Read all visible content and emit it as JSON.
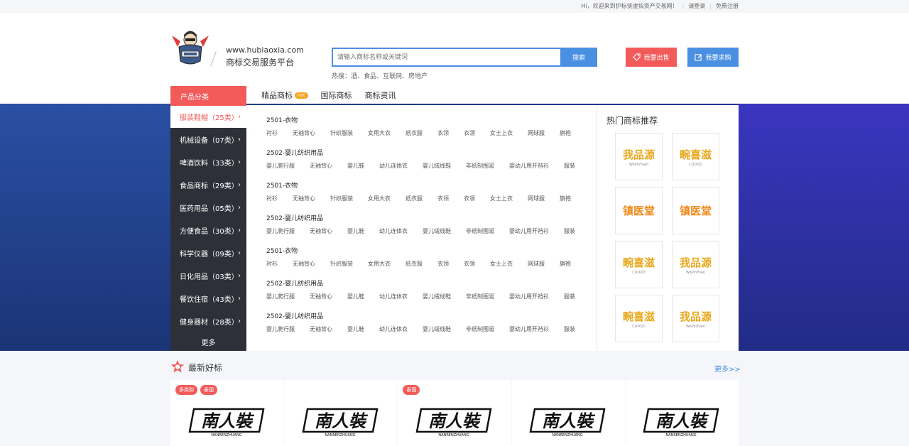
{
  "topbar": {
    "greeting": "Hi，欢迎来到护标侠虚拟资产交易网！",
    "login": "请登录",
    "register": "免费注册"
  },
  "header": {
    "domain": "www.hubiaoxia.com",
    "slogan": "商标交易服务平台",
    "search_placeholder": "请输入商标名称或关键词",
    "search_button": "搜索",
    "hot_words": "热搜：酒、食品、互联网、房地产",
    "sell_button": "我要出售",
    "buy_button": "我要求购"
  },
  "nav": {
    "category_head": "产品分类",
    "tabs": [
      {
        "label": "精品商标",
        "badge": "Hot"
      },
      {
        "label": "国际商标",
        "badge": ""
      },
      {
        "label": "商标资讯",
        "badge": ""
      }
    ]
  },
  "sidebar": {
    "items": [
      {
        "label": "服装鞋帽（25类）",
        "active": true
      },
      {
        "label": "机械设备（07类）",
        "active": false
      },
      {
        "label": "啤酒饮料（33类）",
        "active": false
      },
      {
        "label": "食品商标（29类）",
        "active": false
      },
      {
        "label": "医药用品（05类）",
        "active": false
      },
      {
        "label": "方便食品（30类）",
        "active": false
      },
      {
        "label": "科学仪器（09类）",
        "active": false
      },
      {
        "label": "日化用品（03类）",
        "active": false
      },
      {
        "label": "餐饮住宿（43类）",
        "active": false
      },
      {
        "label": "健身器材（28类）",
        "active": false
      }
    ],
    "more": "更多",
    "chevron": "›"
  },
  "content": {
    "blocks": [
      {
        "title": "2501-衣物",
        "tags": [
          "衬衫",
          "无袖背心",
          "针织服装",
          "女用大衣",
          "纸衣服",
          "衣领",
          "衣领",
          "女士上衣",
          "网球服",
          "旗袍"
        ]
      },
      {
        "title": "2502-婴儿纺织用品",
        "tags": [
          "婴儿爬行服",
          "无袖背心",
          "婴儿鞋",
          "幼儿连体衣",
          "婴儿绒线鞋",
          "非纸制围涎",
          "婴幼儿用开裆衫",
          "服装"
        ]
      },
      {
        "title": "2501-衣物",
        "tags": [
          "衬衫",
          "无袖背心",
          "针织服装",
          "女用大衣",
          "纸衣服",
          "衣领",
          "衣领",
          "女士上衣",
          "网球服",
          "旗袍"
        ]
      },
      {
        "title": "2502-婴儿纺织用品",
        "tags": [
          "婴儿爬行服",
          "无袖背心",
          "婴儿鞋",
          "幼儿连体衣",
          "婴儿绒线鞋",
          "非纸制围涎",
          "婴幼儿用开裆衫",
          "服装"
        ]
      },
      {
        "title": "2501-衣物",
        "tags": [
          "衬衫",
          "无袖背心",
          "针织服装",
          "女用大衣",
          "纸衣服",
          "衣领",
          "衣领",
          "女士上衣",
          "网球服",
          "旗袍"
        ]
      },
      {
        "title": "2502-婴儿纺织用品",
        "tags": [
          "婴儿爬行服",
          "无袖背心",
          "婴儿鞋",
          "幼儿连体衣",
          "婴儿绒线鞋",
          "非纸制围涎",
          "婴幼儿用开裆衫",
          "服装"
        ]
      },
      {
        "title": "2502-婴儿纺织用品",
        "tags": [
          "婴儿爬行服",
          "无袖背心",
          "婴儿鞋",
          "幼儿连体衣",
          "婴儿绒线鞋",
          "非纸制围涎",
          "婴幼儿用开裆衫",
          "服装"
        ]
      }
    ]
  },
  "hot": {
    "title": "热门商标推荐",
    "cards": [
      {
        "text": "我品源",
        "sub": "WoPinYuan",
        "color": "#e8a81c"
      },
      {
        "text": "畹喜滋",
        "sub": "CUIXIZI",
        "color": "#e8a81c"
      },
      {
        "text": "镇医堂",
        "sub": "",
        "color": "#f08a1c"
      },
      {
        "text": "镇医堂",
        "sub": "",
        "color": "#f08a1c"
      },
      {
        "text": "畹喜滋",
        "sub": "CUIXIZI",
        "color": "#e8a81c"
      },
      {
        "text": "我品源",
        "sub": "WoPinYuan",
        "color": "#e8a81c"
      },
      {
        "text": "畹喜滋",
        "sub": "CUIXIZI",
        "color": "#e8a81c"
      },
      {
        "text": "我品源",
        "sub": "WoPinYuan",
        "color": "#e8a81c"
      }
    ]
  },
  "latest": {
    "title": "最新好标",
    "more": "更多>>",
    "cards": [
      {
        "tags": [
          "多类别",
          "泰国"
        ],
        "logo": "南人裝",
        "logo_sub": "NANRENZHUANG"
      },
      {
        "tags": [],
        "logo": "南人裝",
        "logo_sub": "NANRENZHUANG"
      },
      {
        "tags": [
          "泰国"
        ],
        "logo": "南人裝",
        "logo_sub": "NANRENZHUANG"
      },
      {
        "tags": [],
        "logo": "南人裝",
        "logo_sub": "NANRENZHUANG"
      },
      {
        "tags": [],
        "logo": "南人裝",
        "logo_sub": "NANRENZHUANG"
      }
    ]
  },
  "colors": {
    "accent_red": "#f35b5b",
    "accent_blue": "#4a90e2",
    "sidebar_bg": "#2d3038",
    "banner_blue": "#203e7e"
  }
}
